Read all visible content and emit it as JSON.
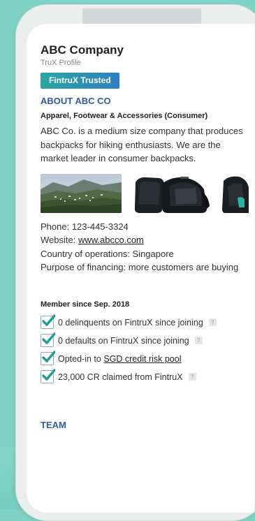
{
  "company": {
    "name": "ABC Company",
    "profile_label": "TruX Profile",
    "badge": "FintruX Trusted"
  },
  "about": {
    "heading": "ABOUT ABC CO",
    "category": "Apparel, Footwear & Accessories (Consumer)",
    "description": "ABC Co. is a medium size company that produces backpacks for hiking enthusiasts. We are the market leader in consumer backpacks."
  },
  "gallery": {
    "images": [
      "landscape-photo",
      "backpack-photo",
      "backpack-photo"
    ]
  },
  "contact": {
    "phone": "Phone: 123-445-3324",
    "website_label": "Website: ",
    "website": "www.abcco.com",
    "country": "Country of operations: Singapore",
    "purpose": "Purpose of financing: more customers are buying"
  },
  "membership": {
    "since": "Member since Sep. 2018",
    "items": [
      {
        "text": "0 delinquents on FintruX since joining",
        "help": "?"
      },
      {
        "text": "0 defaults on FintruX since joining",
        "help": "?"
      },
      {
        "prefix": "Opted-in to ",
        "link": "SGD credit risk pool"
      },
      {
        "text": "23,000 CR claimed from FintruX",
        "help": "?"
      }
    ]
  },
  "team": {
    "heading": "TEAM"
  },
  "colors": {
    "background": "#7fd3c6",
    "accent_blue": "#2a5ea8",
    "badge_start": "#2aa6a0",
    "badge_end": "#2e7fc4",
    "check_teal": "#1f9c93"
  }
}
